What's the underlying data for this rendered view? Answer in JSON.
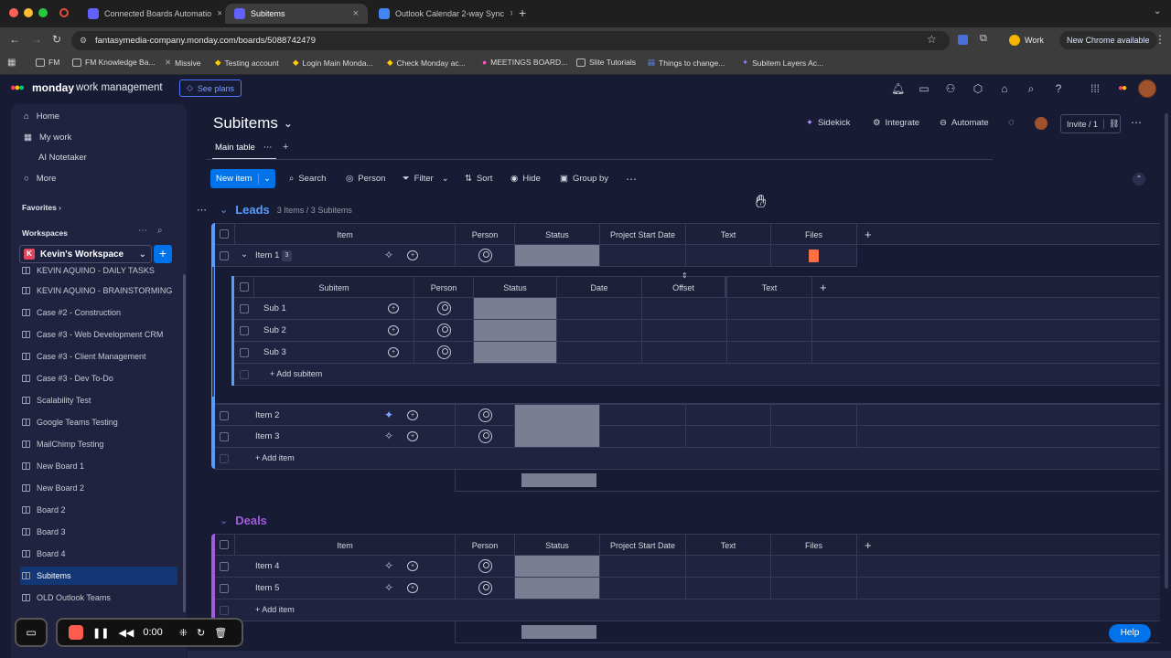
{
  "browser": {
    "tabs": [
      {
        "label": "Connected Boards Automatio",
        "active": false
      },
      {
        "label": "Subitems",
        "active": true
      },
      {
        "label": "Outlook Calendar 2-way Sync",
        "active": false
      }
    ],
    "url": "fantasymedia-company.monday.com/boards/5088742479",
    "profile_label": "Work",
    "update_label": "New Chrome available",
    "bookmarks": [
      "FM",
      "FM Knowledge Ba...",
      "Missive",
      "Testing account",
      "Login Main Monda...",
      "Check Monday ac...",
      "MEETINGS BOARD...",
      "Slite Tutorials",
      "Things to change...",
      "Subitem Layers Ac..."
    ]
  },
  "app": {
    "logo_brand": "monday",
    "logo_product": "work management",
    "see_plans_label": "See plans"
  },
  "sidebar": {
    "nav": [
      "Home",
      "My work",
      "AI Notetaker",
      "More"
    ],
    "favorites_label": "Favorites",
    "workspaces_label": "Workspaces",
    "workspace_initial": "K",
    "workspace_name": "Kevin's Workspace",
    "boards": [
      "KEVIN AQUINO - DAILY TASKS",
      "KEVIN AQUINO - BRAINSTORMING",
      "Case #2 - Construction",
      "Case #3 - Web Development CRM",
      "Case #3 - Client Management",
      "Case #3 - Dev To-Do",
      "Scalability Test",
      "Google Teams Testing",
      "MailChimp Testing",
      "New Board 1",
      "New Board 2",
      "Board 2",
      "Board 3",
      "Board 4",
      "Subitems",
      "OLD Outlook Teams"
    ],
    "selected_board": "Subitems"
  },
  "board": {
    "title": "Subitems",
    "view_tab": "Main table",
    "sidekick_label": "Sidekick",
    "integrate_label": "Integrate",
    "automate_label": "Automate",
    "invite_label": "Invite / 1",
    "new_item_label": "New item",
    "toolbar": {
      "search": "Search",
      "person": "Person",
      "filter": "Filter",
      "sort": "Sort",
      "hide": "Hide",
      "group_by": "Group by"
    },
    "columns": [
      "Item",
      "Person",
      "Status",
      "Project Start Date",
      "Text",
      "Files"
    ],
    "sub_columns": [
      "Subitem",
      "Person",
      "Status",
      "Date",
      "Offset",
      "Text"
    ],
    "groups": [
      {
        "name": "Leads",
        "summary": "3 Items / 3 Subitems",
        "color": "#579bfc",
        "items": [
          {
            "name": "Item 1",
            "sub_count": "3",
            "expanded": true,
            "subitems": [
              "Sub 1",
              "Sub 2",
              "Sub 3"
            ]
          },
          {
            "name": "Item 2"
          },
          {
            "name": "Item 3"
          }
        ],
        "add_subitem_label": "+ Add subitem",
        "add_item_label": "+ Add item"
      },
      {
        "name": "Deals",
        "color": "#a25ddc",
        "items": [
          {
            "name": "Item 4"
          },
          {
            "name": "Item 5"
          }
        ],
        "add_item_label": "+ Add item"
      }
    ]
  },
  "recorder": {
    "time": "0:00"
  },
  "help_label": "Help"
}
